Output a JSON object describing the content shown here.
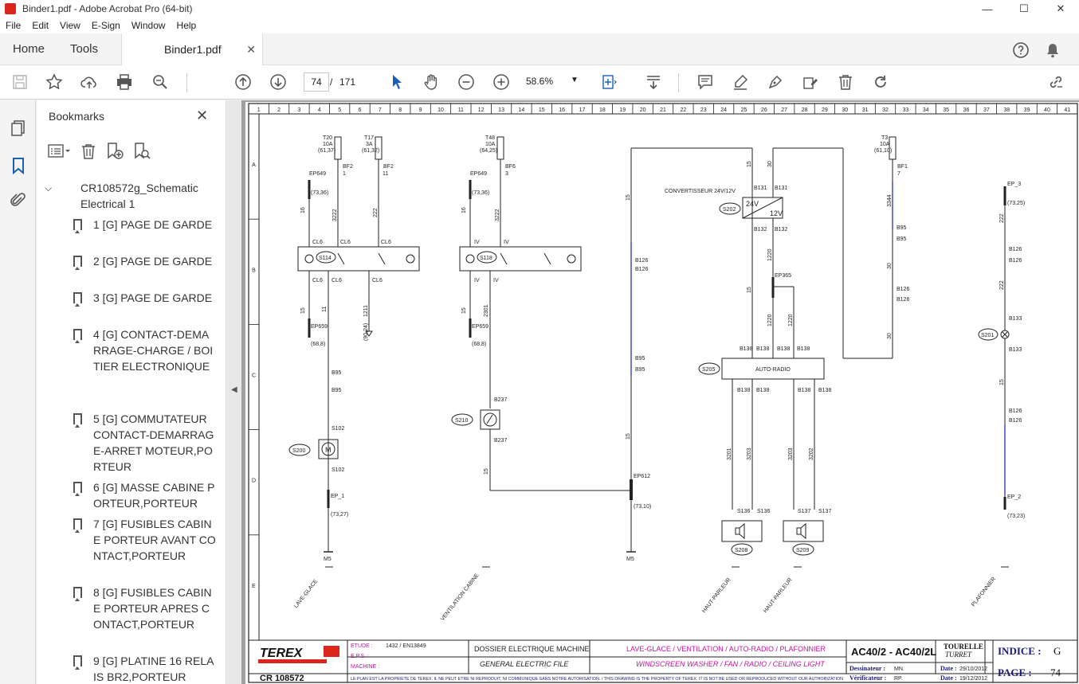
{
  "window": {
    "title": "Binder1.pdf - Adobe Acrobat Pro (64-bit)",
    "minimize": "—",
    "maximize": "☐",
    "close": "✕"
  },
  "menu": [
    "File",
    "Edit",
    "View",
    "E-Sign",
    "Window",
    "Help"
  ],
  "tabs": {
    "home": "Home",
    "tools": "Tools",
    "document": "Binder1.pdf",
    "close_glyph": "✕"
  },
  "toolbar": {
    "current_page": "74",
    "page_separator": "/",
    "total_pages": "171",
    "zoom": "58.6%",
    "zoom_caret": "▼"
  },
  "bookmarks": {
    "title": "Bookmarks",
    "close_glyph": "✕",
    "options_caret": "▾",
    "root": "CR108572g_Schematic Electrical 1",
    "root_chevron": "⌵",
    "items": [
      "1 [G] PAGE DE GARDE",
      "2 [G] PAGE DE GARDE",
      "3 [G] PAGE DE GARDE",
      "4 [G] CONTACT-DEMARRAGE-CHARGE / BOITIER ELECTRONIQUE",
      "5 [G] COMMUTATEUR CONTACT-DEMARRAGE-ARRET MOTEUR,PORTEUR",
      "6 [G] MASSE CABINE PORTEUR,PORTEUR",
      "7 [G] FUSIBLES CABINE PORTEUR AVANT CONTACT,PORTEUR",
      "8 [G] FUSIBLES CABINE PORTEUR APRES CONTACT,PORTEUR",
      "9 [G] PLATINE 16 RELAIS BR2,PORTEUR"
    ],
    "scroll_down_glyph": "▼"
  },
  "splitter_glyph": "◀",
  "schematic": {
    "col_numbers": [
      "1",
      "2",
      "3",
      "4",
      "5",
      "6",
      "7",
      "8",
      "9",
      "10",
      "11",
      "12",
      "13",
      "14",
      "15",
      "16",
      "17",
      "18",
      "19",
      "20",
      "21",
      "22",
      "23",
      "24",
      "25",
      "26",
      "27",
      "28",
      "29",
      "30",
      "31",
      "32",
      "33",
      "34",
      "35",
      "36",
      "37",
      "38",
      "39",
      "40",
      "41"
    ],
    "row_letters": [
      "A",
      "B",
      "C",
      "D",
      "E"
    ],
    "fuses": [
      {
        "id": "T20",
        "rating": "10A",
        "ref": "(61,37)",
        "conn": "BF2",
        "pin": "1"
      },
      {
        "id": "T17",
        "rating": "3A",
        "ref": "(61,32)",
        "conn": "BF2",
        "pin": "11"
      },
      {
        "id": "T48",
        "rating": "10A",
        "ref": "(64,25)",
        "conn": "BF6",
        "pin": "3"
      },
      {
        "id": "T3",
        "rating": "10A",
        "ref": "(61,10)",
        "conn": "BF1",
        "pin": "7"
      }
    ],
    "components": {
      "s114": "S114",
      "s118": "S118",
      "s200": "S200",
      "s210": "S210",
      "s202": "S202",
      "s205": "S205",
      "s208": "S208",
      "s209": "S209",
      "s201": "S201",
      "converter": "CONVERTISSEUR 24V/12V",
      "conv_24": "24V",
      "conv_12": "12V",
      "radio": "AUTO-RADIO",
      "motor": "M"
    },
    "labels": {
      "ep649": "EP649",
      "ep649_ref": "(73,36)",
      "ep659": "EP659",
      "ep659_ref": "(68,8)",
      "ep_1": "EP_1",
      "ep_1_ref": "(73,27)",
      "ep612": "EP612",
      "ep612_ref": "(73,10)",
      "ep365": "EP365",
      "ep_3": "EP_3",
      "ep_3_ref": "(73,25)",
      "ep_2": "EP_2",
      "ep_2_ref": "(73,23)",
      "ref_9024": "(90,24)",
      "m5": "M5",
      "wire_3222": "3222",
      "wire_222": "222",
      "wire_16": "16",
      "wire_15": "15",
      "wire_11": "11",
      "wire_1211": "1211",
      "wire_2301": "2301",
      "wire_30": "30",
      "wire_1220": "1220",
      "wire_3344": "3344",
      "wire_3201": "3201",
      "wire_3203": "3203",
      "wire_3202": "3202",
      "cl6": "CL6",
      "iv": "IV",
      "b95": "B95",
      "b126": "B126",
      "b131": "B131",
      "b132": "B132",
      "b133": "B133",
      "b138": "B138",
      "b237": "B237",
      "s102": "S102",
      "s136": "S136",
      "s137": "S137"
    },
    "footer_labels": [
      "LAVE-GLACE",
      "VENTILATION CABINE",
      "HAUT-PARLEUR",
      "HAUT-PARLEUR",
      "PLAFONNIER"
    ],
    "title_block": {
      "brand": "TEREX",
      "doc_number": "CR 108572",
      "etude_label": "ETUDE :",
      "etude_value": "1432 / EN13849",
      "eps_label": "E.P.S. :",
      "machine_label": "MACHINE :",
      "dossier_fr": "DOSSIER ELECTRIQUE MACHINE",
      "dossier_en": "GENERAL ELECTRIC FILE",
      "function_fr": "LAVE-GLACE / VENTILATION / AUTO-RADIO / PLAFONNIER",
      "function_en": "WINDSCREEN WASHER / FAN / RADIO / CEILING LIGHT",
      "model": "AC40/2 - AC40/2L",
      "turret_fr": "TOURELLE",
      "turret_en": "TURRET",
      "indice_label": "INDICE :",
      "indice_value": "G",
      "page_label": "PAGE :",
      "page_value": "74",
      "dessinateur_label": "Dessinateur :",
      "dessinateur_value": "MN.",
      "verificateur_label": "Vérificateur :",
      "verificateur_value": "RP.",
      "date_label": "Date :",
      "date1": "29/10/2012",
      "date2": "19/12/2012",
      "notice": "LE PLAN EST LA PROPRIETE DE TEREX. IL NE PEUT ETRE NI REPRODUIT, NI COMMUNIQUE SANS NOTRE AUTORISATION. / THIS DRAWING IS THE PROPERTY OF TEREX. IT IS NOT BE USED OR REPRODUCED WITHOUT OUR AUTHORIZATION"
    }
  },
  "colors": {
    "accent_red": "#d9251c",
    "wire_blue": "#1a1aa8",
    "magenta_text": "#c0189c",
    "navy_text": "#1a1a70"
  }
}
